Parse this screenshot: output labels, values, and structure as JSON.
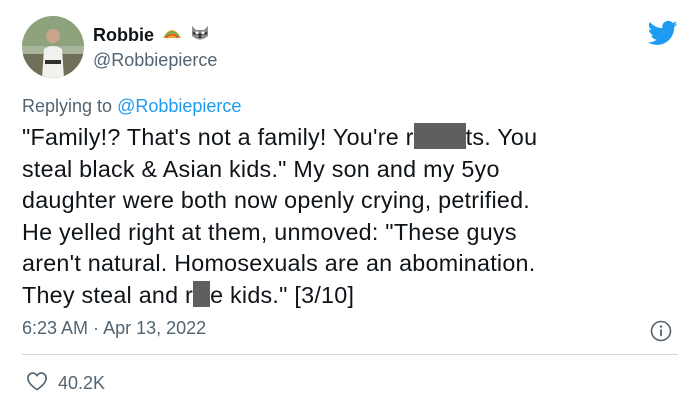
{
  "user": {
    "display_name": "Robbie",
    "handle": "@Robbiepierce",
    "badges": [
      "taco-emoji",
      "raccoon-emoji"
    ]
  },
  "reply_context": {
    "prefix": "Replying to",
    "mention": "@Robbiepierce"
  },
  "tweet": {
    "segments": {
      "l1a": "\"Family!? That's not a family! You're r",
      "l1b": "ts. You",
      "l2": "steal black & Asian kids.\" My son and my 5yo",
      "l3": "daughter were both now openly crying, petrified.",
      "l4": "He yelled right at them, unmoved: \"These guys",
      "l5": "aren't natural. Homosexuals are an abomination.",
      "l6a": "They steal and r",
      "l6b": "e kids.\" [3/10]"
    }
  },
  "meta": {
    "time": "6:23 AM",
    "separator": " · ",
    "date": "Apr 13, 2022"
  },
  "likes": {
    "count": "40.2K"
  },
  "colors": {
    "brand": "#1d9bf0",
    "text": "#0f1419",
    "secondary": "#536471",
    "divider": "#cfd9de"
  },
  "icons": [
    "twitter-bird-icon",
    "info-icon",
    "heart-icon"
  ]
}
